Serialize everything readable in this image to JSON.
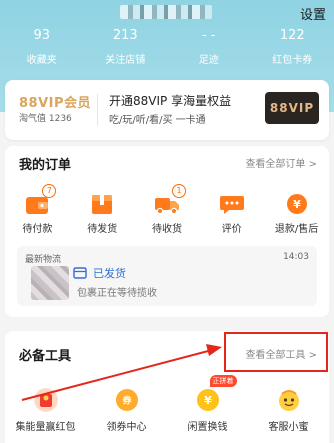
{
  "header": {
    "settings_label": "设置",
    "stats": [
      {
        "value": "93",
        "label": "收藏夹"
      },
      {
        "value": "213",
        "label": "关注店铺"
      },
      {
        "value": "- -",
        "label": "足迹"
      },
      {
        "value": "122",
        "label": "红包卡券"
      }
    ],
    "background_color": "#8fd3e3"
  },
  "vip": {
    "logo_text": "88VIP会员",
    "taoqi_value": "淘气值 1236",
    "title": "开通88VIP 享海量权益",
    "subtitle": "吃/玩/听/看/买 一卡通",
    "badge_text": "88VIP"
  },
  "orders": {
    "title": "我的订单",
    "view_all": "查看全部订单 >",
    "items": [
      {
        "label": "待付款",
        "icon": "wallet-icon",
        "badge": "7"
      },
      {
        "label": "待发货",
        "icon": "package-icon",
        "badge": ""
      },
      {
        "label": "待收货",
        "icon": "truck-icon",
        "badge": "1"
      },
      {
        "label": "评价",
        "icon": "chat-icon",
        "badge": ""
      },
      {
        "label": "退款/售后",
        "icon": "refund-icon",
        "badge": ""
      }
    ],
    "logistics": {
      "title": "最新物流",
      "time": "14:03",
      "status": "已发货",
      "description": "包裹正在等待揽收"
    }
  },
  "tools": {
    "title": "必备工具",
    "view_all": "查看全部工具 >",
    "items": [
      {
        "label": "集能量赢红包",
        "icon": "red-envelope-icon"
      },
      {
        "label": "领券中心",
        "icon": "coupon-icon"
      },
      {
        "label": "闲置换钱",
        "icon": "yuan-coin-icon",
        "tag": "正拼着"
      },
      {
        "label": "客服小蜜",
        "icon": "assistant-icon"
      }
    ]
  },
  "colors": {
    "accent_orange": "#ff6a00",
    "highlight_red": "#e3271c",
    "logistics_blue": "#2f6fd6",
    "vip_gold": "#d8a65c"
  }
}
